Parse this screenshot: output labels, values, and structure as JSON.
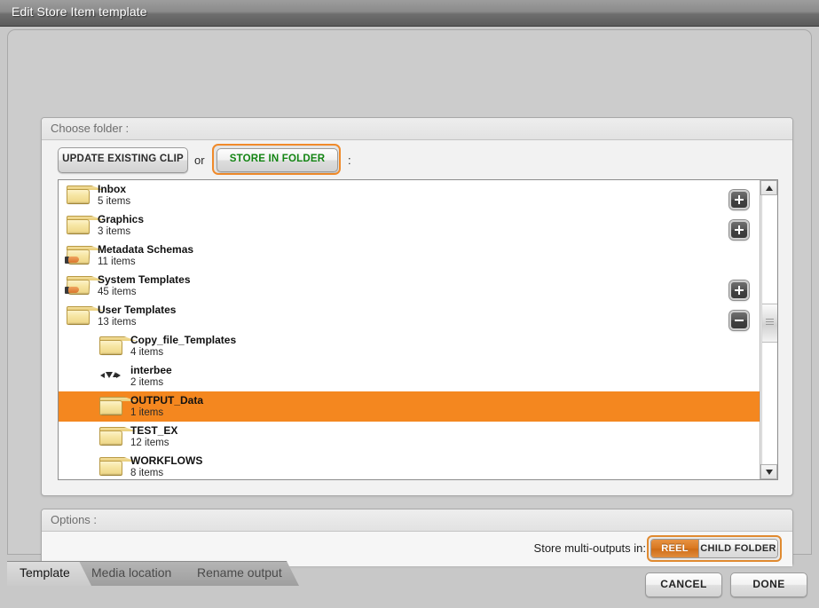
{
  "window": {
    "title": "Edit Store Item template"
  },
  "colors": {
    "selection": "#f4871f",
    "focus_ring": "#f08a2a",
    "store_in_folder_text": "#138413",
    "toggle_on": "#d9771f"
  },
  "folder_group": {
    "header": "Choose folder :",
    "update_existing_clip_label": "UPDATE EXISTING CLIP",
    "or_label": "or",
    "store_in_folder_label": "STORE IN FOLDER",
    "trailing_colon": ":",
    "rows": [
      {
        "name": "Inbox",
        "count": "5 items",
        "icon": "folder-icon",
        "indent": 0,
        "selected": false,
        "expander": "plus"
      },
      {
        "name": "Graphics",
        "count": "3 items",
        "icon": "folder-icon",
        "indent": 0,
        "selected": false,
        "expander": "plus"
      },
      {
        "name": "Metadata Schemas",
        "count": "11 items",
        "icon": "shared-folder-icon",
        "indent": 0,
        "selected": false,
        "expander": "none"
      },
      {
        "name": "System Templates",
        "count": "45 items",
        "icon": "shared-folder-icon",
        "indent": 0,
        "selected": false,
        "expander": "plus"
      },
      {
        "name": "User Templates",
        "count": "13 items",
        "icon": "folder-icon",
        "indent": 0,
        "selected": false,
        "expander": "minus"
      },
      {
        "name": "Copy_file_Templates",
        "count": "4 items",
        "icon": "folder-icon",
        "indent": 1,
        "selected": false,
        "expander": "none"
      },
      {
        "name": "interbee",
        "count": "2 items",
        "icon": "arrows-icon",
        "indent": 1,
        "selected": false,
        "expander": "none"
      },
      {
        "name": "OUTPUT_Data",
        "count": "1 items",
        "icon": "folder-icon",
        "indent": 1,
        "selected": true,
        "expander": "none"
      },
      {
        "name": "TEST_EX",
        "count": "12 items",
        "icon": "folder-icon",
        "indent": 1,
        "selected": false,
        "expander": "none"
      },
      {
        "name": "WORKFLOWS",
        "count": "8 items",
        "icon": "folder-icon",
        "indent": 1,
        "selected": false,
        "expander": "none"
      }
    ]
  },
  "options_group": {
    "header": "Options :",
    "multi_output_label": "Store multi-outputs in:",
    "toggle": {
      "selected": "REEL",
      "options": [
        "REEL",
        "CHILD FOLDER"
      ]
    }
  },
  "tabs": [
    {
      "label": "Template",
      "active": true
    },
    {
      "label": "Media location",
      "active": false
    },
    {
      "label": "Rename output",
      "active": false
    }
  ],
  "footer": {
    "cancel_label": "CANCEL",
    "done_label": "DONE"
  }
}
